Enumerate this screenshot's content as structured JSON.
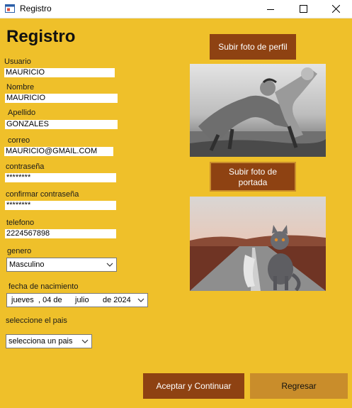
{
  "window": {
    "title": "Registro"
  },
  "form": {
    "heading": "Registro",
    "usuario": {
      "label": "Usuario",
      "value": "MAURICIO"
    },
    "nombre": {
      "label": "Nombre",
      "value": "MAURICIO"
    },
    "apellido": {
      "label": "Apellido",
      "value": "GONZALES"
    },
    "correo": {
      "label": "correo",
      "value": "MAURICIO@GMAIL.COM"
    },
    "contrasena": {
      "label": "contraseña",
      "value": "********"
    },
    "confirmar": {
      "label": "confirmar contraseña",
      "value": "********"
    },
    "telefono": {
      "label": "telefono",
      "value": "2224567898"
    },
    "genero": {
      "label": "genero",
      "value": "Masculino"
    },
    "fecha": {
      "label": "fecha de nacimiento",
      "weekday": "jueves",
      "day": ", 04 de",
      "month": "julio",
      "year": "de 2024"
    },
    "pais": {
      "label": "seleccione el pais",
      "value": "selecciona un pais"
    }
  },
  "media": {
    "profile_button": "Subir foto de perfil",
    "cover_button_line1": "Subir foto de",
    "cover_button_line2": "portada"
  },
  "actions": {
    "accept": "Aceptar y Continuar",
    "back": "Regresar"
  },
  "colors": {
    "background": "#efc02a",
    "button_dark": "#8e4212",
    "button_light": "#c98d2b"
  }
}
